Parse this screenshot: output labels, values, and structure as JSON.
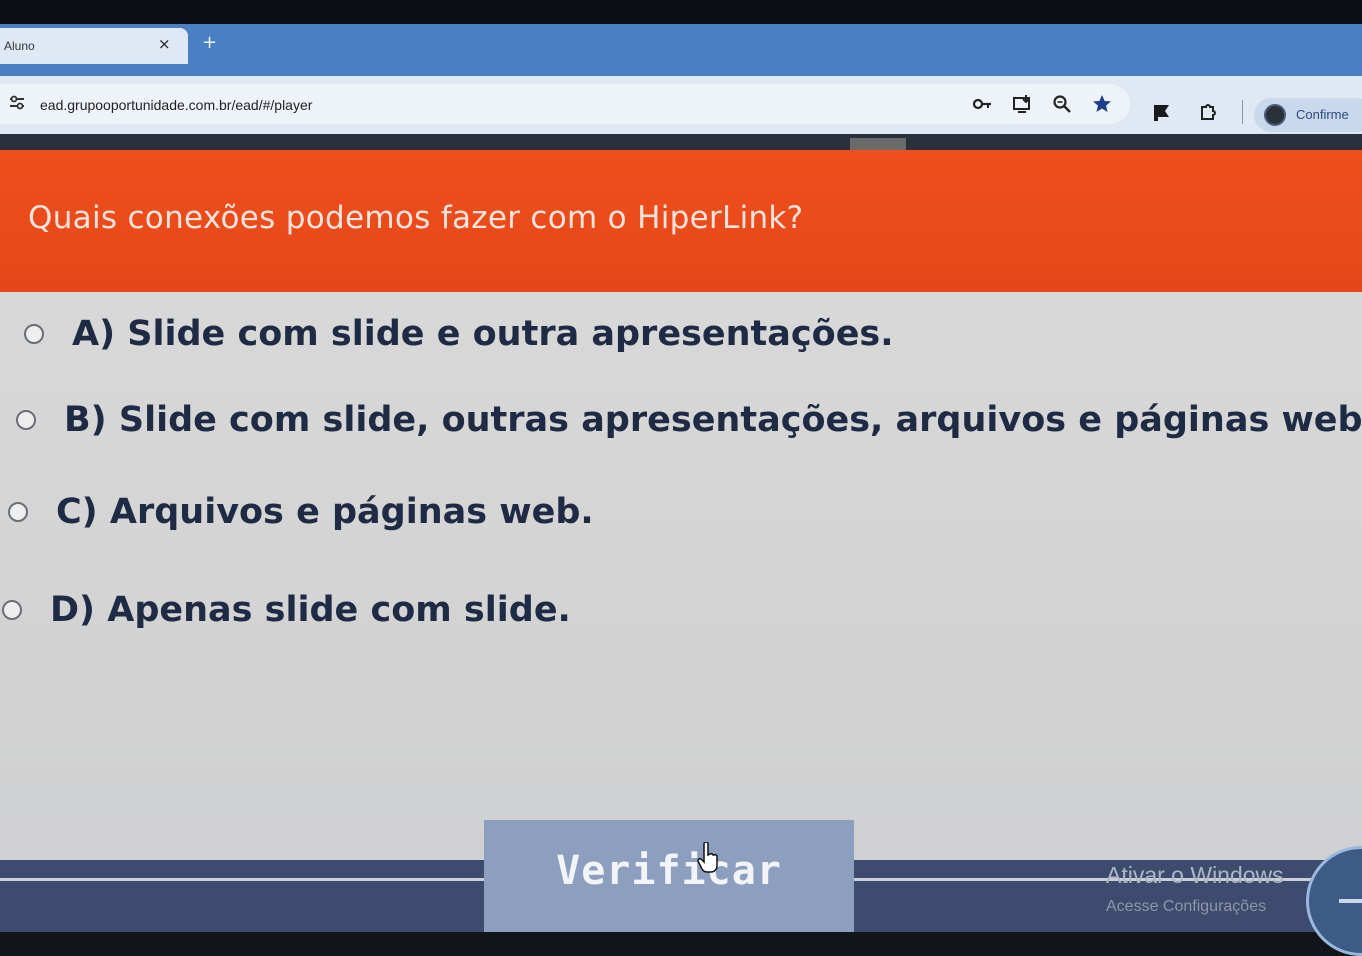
{
  "browser": {
    "tab": {
      "title": "Aluno",
      "close_glyph": "×"
    },
    "new_tab_glyph": "+",
    "url": "ead.grupooportunidade.com.br/ead/#/player",
    "omnibox_icons": [
      "key-icon",
      "install-app-icon",
      "zoom-icon",
      "bookmark-star-icon"
    ],
    "toolbar_icons": [
      "flag-extension-icon",
      "extensions-puzzle-icon"
    ],
    "profile_button": {
      "label": "Confirme",
      "icon": "avatar-icon"
    },
    "accent": "#4a7fc4"
  },
  "quiz": {
    "question": "Quais conexões podemos fazer com o HiperLink?",
    "options": [
      {
        "letter": "A)",
        "text": "Slide com slide e outra apresentações."
      },
      {
        "letter": "B)",
        "text": "Slide com slide, outras apresentações, arquivos e páginas web."
      },
      {
        "letter": "C)",
        "text": "Arquivos e páginas web."
      },
      {
        "letter": "D)",
        "text": "Apenas slide com slide."
      }
    ],
    "verify_button": "Verificar",
    "colors": {
      "question_bar": "#e84a1b",
      "options_bg": "#d6d6d6",
      "option_text": "#1f2a44",
      "button": "#8d9fbf"
    }
  },
  "windows_watermark": {
    "title": "Ativar o Windows",
    "subtitle": "Acesse Configurações"
  }
}
